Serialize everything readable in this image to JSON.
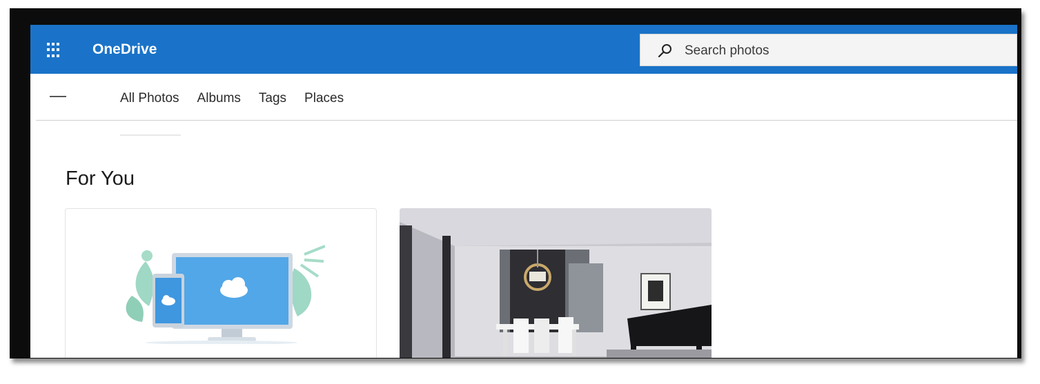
{
  "header": {
    "app_name": "OneDrive",
    "brand_color": "#1a73c8",
    "app_launcher_icon": "waffle-icon",
    "search": {
      "placeholder": "Search photos",
      "icon": "search-icon"
    }
  },
  "nav": {
    "menu_icon": "hamburger-icon",
    "tabs": [
      {
        "label": "All Photos",
        "active": true
      },
      {
        "label": "Albums",
        "active": false
      },
      {
        "label": "Tags",
        "active": false
      },
      {
        "label": "Places",
        "active": false
      }
    ]
  },
  "main": {
    "section_title": "For You",
    "cards": [
      {
        "kind": "illustration",
        "description_icon": "cloud-devices-icon"
      },
      {
        "kind": "photo",
        "description_icon": "interior-photo"
      }
    ]
  }
}
